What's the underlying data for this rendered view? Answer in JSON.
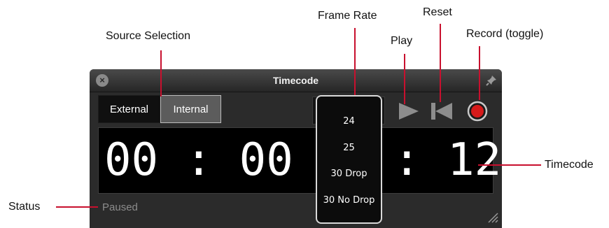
{
  "callouts": {
    "source_selection": "Source Selection",
    "frame_rate": "Frame Rate",
    "play": "Play",
    "reset": "Reset",
    "record": "Record (toggle)",
    "timecode": "Timecode",
    "status": "Status"
  },
  "window": {
    "title": "Timecode",
    "close_glyph": "×"
  },
  "source": {
    "external_label": "External",
    "internal_label": "Internal",
    "selected": "Internal"
  },
  "timecode": {
    "left_part": "00 : 00 :",
    "frames_part": ": 12"
  },
  "frame_rate_menu": {
    "options": [
      "24",
      "25",
      "30 Drop",
      "30 No Drop"
    ]
  },
  "status": {
    "text": "Paused"
  },
  "icons": {
    "close": "close-icon",
    "pin": "pin-icon",
    "play": "play-icon",
    "reset": "skip-to-start-icon",
    "record": "record-icon",
    "resize": "resize-grip-icon"
  },
  "colors": {
    "leader_line": "#c8102e",
    "record_red": "#d51a1a",
    "window_bg": "#2b2b2b"
  }
}
